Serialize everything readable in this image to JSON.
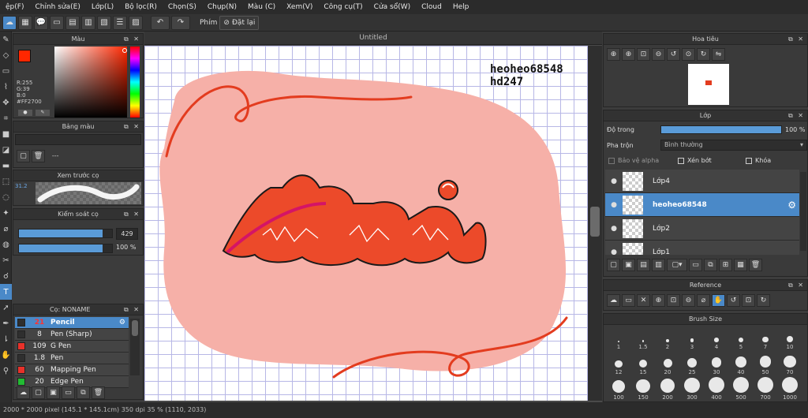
{
  "menu": [
    "ệp(F)",
    "Chỉnh sửa(E)",
    "Lớp(L)",
    "Bộ lọc(R)",
    "Chọn(S)",
    "Chụp(N)",
    "Màu (C)",
    "Xem(V)",
    "Công cụ(T)",
    "Cửa sổ(W)",
    "Cloud",
    "Help"
  ],
  "toolbar": {
    "label": "Phím",
    "reset_label": "Đặt lại"
  },
  "document": {
    "tab_title": "Untitled",
    "watermark_line1": "heoheo68548",
    "watermark_line2": "hd247"
  },
  "color_panel": {
    "title": "Màu",
    "rgb_r": "R:255",
    "rgb_g": "G:39",
    "rgb_b": "B:0",
    "hex": "#FF2700",
    "fg_color": "#FF2700",
    "bg_color": "#FFFFFF"
  },
  "palette_panel": {
    "title": "Bảng màu",
    "name": "---"
  },
  "preview_panel": {
    "title": "Xem trước cọ",
    "size": "31.2"
  },
  "brush_control": {
    "title": "Kiểm soát cọ",
    "size_value": "429",
    "opacity_value": "100 %",
    "size_fill": 0.9,
    "opacity_fill": 0.9
  },
  "brush_panel": {
    "title": "Cọ: NONAME",
    "brushes": [
      {
        "size": "21",
        "name": "Pencil",
        "color": "#2f2f2f",
        "selected": true
      },
      {
        "size": "8",
        "name": "Pen (Sharp)",
        "color": "#2f2f2f"
      },
      {
        "size": "109",
        "name": "G Pen",
        "color": "#e8312a"
      },
      {
        "size": "1.8",
        "name": "Pen",
        "color": "#2f2f2f"
      },
      {
        "size": "60",
        "name": "Mapping Pen",
        "color": "#e8312a"
      },
      {
        "size": "20",
        "name": "Edge Pen",
        "color": "#22bb33"
      }
    ]
  },
  "navigator": {
    "title": "Hoa tiêu"
  },
  "layer_panel": {
    "title": "Lớp",
    "opacity_label": "Độ trong",
    "opacity_value": "100 %",
    "opacity_fill": 1.0,
    "blend_label": "Pha trộn",
    "blend_value": "Bình thường",
    "alpha_protect": "Bảo vệ alpha",
    "clipping": "Xén bớt",
    "lock": "Khóa",
    "layers": [
      {
        "name": "Lớp4",
        "selected": false
      },
      {
        "name": "heoheo68548",
        "selected": true
      },
      {
        "name": "Lớp2",
        "selected": false
      },
      {
        "name": "Lớp1",
        "selected": false
      }
    ]
  },
  "reference_panel": {
    "title": "Reference"
  },
  "brush_size_panel": {
    "title": "Brush Size",
    "sizes": [
      "1",
      "1.5",
      "2",
      "3",
      "4",
      "5",
      "7",
      "10",
      "12",
      "15",
      "20",
      "25",
      "30",
      "40",
      "50",
      "70",
      "100",
      "150",
      "200",
      "300",
      "400",
      "500",
      "700",
      "1000"
    ]
  },
  "status": {
    "text": "2000 * 2000 pixel  (145.1 * 145.1cm)  350 dpi  35 %  (1110, 2033)"
  }
}
